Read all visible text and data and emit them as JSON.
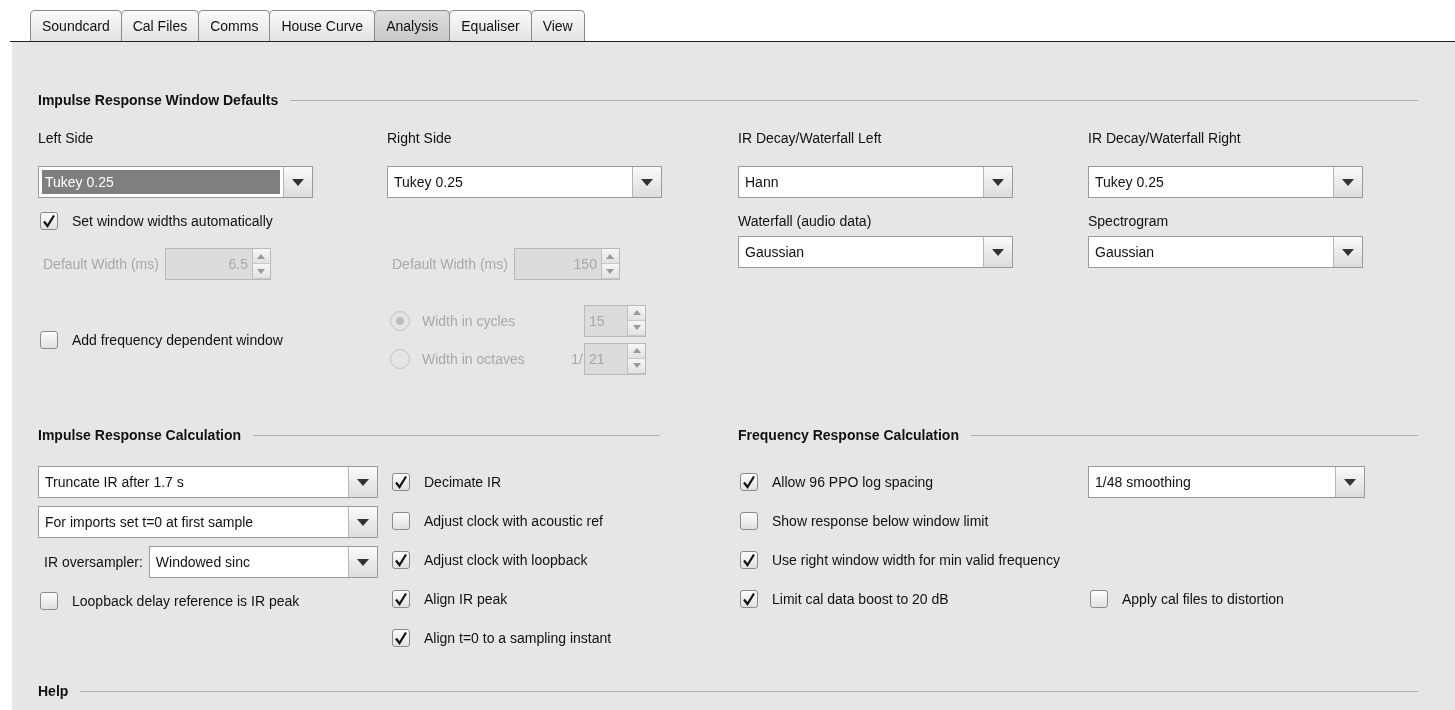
{
  "tabs": [
    {
      "label": "Soundcard",
      "selected": false
    },
    {
      "label": "Cal Files",
      "selected": false
    },
    {
      "label": "Comms",
      "selected": false
    },
    {
      "label": "House Curve",
      "selected": false
    },
    {
      "label": "Analysis",
      "selected": true
    },
    {
      "label": "Equaliser",
      "selected": false
    },
    {
      "label": "View",
      "selected": false
    }
  ],
  "ir_window": {
    "title": "Impulse Response Window Defaults",
    "window_dropdowns": [
      {
        "label": "Left Side",
        "value": "Tukey 0.25",
        "focused": true
      },
      {
        "label": "Right Side",
        "value": "Tukey 0.25",
        "focused": false
      },
      {
        "label": "IR Decay/Waterfall Left",
        "value": "Hann",
        "focused": false
      },
      {
        "label": "IR Decay/Waterfall Right",
        "value": "Tukey 0.25",
        "focused": false
      }
    ],
    "auto_width": {
      "label": "Set window widths automatically",
      "checked": true
    },
    "other_dropdowns": [
      {
        "label": "Waterfall (audio data)",
        "value": "Gaussian",
        "focused": false
      },
      {
        "label": "Spectrogram",
        "value": "Gaussian",
        "focused": false
      }
    ],
    "default_widths": [
      {
        "label": "Default Width (ms)",
        "value": "6.5",
        "disabled": true
      },
      {
        "label": "Default Width (ms)",
        "value": "150",
        "disabled": true
      }
    ],
    "freq_window": {
      "label": "Add frequency dependent window",
      "checked": false
    },
    "freq_options": [
      {
        "label": "Width in cycles",
        "selected": true,
        "value": "15",
        "disabled": true
      },
      {
        "label": "Width in octaves",
        "selected": false,
        "prefix": "1/",
        "value": "21",
        "disabled": true
      }
    ]
  },
  "ir_calc": {
    "title": "Impulse Response Calculation",
    "dropdowns": [
      {
        "value": "Truncate IR after 1.7 s"
      },
      {
        "value": "For imports set t=0 at first sample"
      },
      {
        "label": "IR oversampler:",
        "value": "Windowed sinc"
      }
    ],
    "loopback": {
      "label": "Loopback delay reference is IR peak",
      "checked": false
    },
    "checks": [
      {
        "label": "Decimate IR",
        "checked": true
      },
      {
        "label": "Adjust clock with acoustic ref",
        "checked": false
      },
      {
        "label": "Adjust clock with loopback",
        "checked": true
      },
      {
        "label": "Align IR peak",
        "checked": true
      },
      {
        "label": "Align t=0 to a sampling instant",
        "checked": true
      }
    ]
  },
  "fr_calc": {
    "title": "Frequency Response Calculation",
    "checks": [
      {
        "label": "Allow 96 PPO log spacing",
        "checked": true
      },
      {
        "label": "Show response below window limit",
        "checked": false
      },
      {
        "label": "Use right window width for min valid frequency",
        "checked": true
      },
      {
        "label": "Limit cal data boost to 20 dB",
        "checked": true
      }
    ],
    "smoothing": {
      "value": "1/48 smoothing"
    },
    "cal_distortion": {
      "label": "Apply cal files to distortion",
      "checked": false
    }
  },
  "help": {
    "title": "Help"
  }
}
